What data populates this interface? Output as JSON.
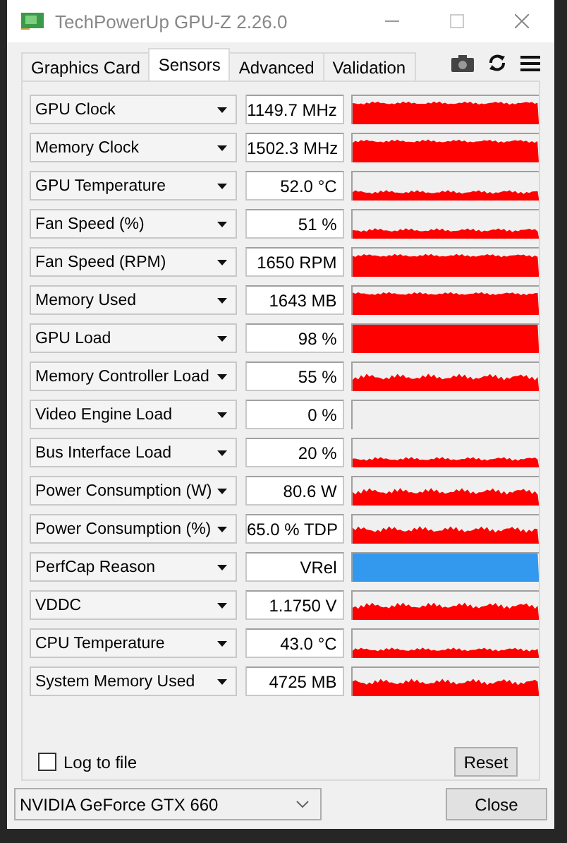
{
  "window": {
    "title": "TechPowerUp GPU-Z 2.26.0"
  },
  "tabs": [
    {
      "label": "Graphics Card",
      "selected": false
    },
    {
      "label": "Sensors",
      "selected": true
    },
    {
      "label": "Advanced",
      "selected": false
    },
    {
      "label": "Validation",
      "selected": false
    }
  ],
  "sensors": [
    {
      "name": "GPU Clock",
      "value": "1149.7 MHz",
      "kind": "high",
      "color": "#ff0000"
    },
    {
      "name": "Memory Clock",
      "value": "1502.3 MHz",
      "kind": "high",
      "color": "#ff0000"
    },
    {
      "name": "GPU Temperature",
      "value": "52.0 °C",
      "kind": "low",
      "color": "#ff0000"
    },
    {
      "name": "Fan Speed (%)",
      "value": "51 %",
      "kind": "low",
      "color": "#ff0000"
    },
    {
      "name": "Fan Speed (RPM)",
      "value": "1650 RPM",
      "kind": "high",
      "color": "#ff0000"
    },
    {
      "name": "Memory Used",
      "value": "1643 MB",
      "kind": "high",
      "color": "#ff0000"
    },
    {
      "name": "GPU Load",
      "value": "98 %",
      "kind": "full",
      "color": "#ff0000"
    },
    {
      "name": "Memory Controller Load",
      "value": "55 %",
      "kind": "mid",
      "color": "#ff0000"
    },
    {
      "name": "Video Engine Load",
      "value": "0 %",
      "kind": "empty"
    },
    {
      "name": "Bus Interface Load",
      "value": "20 %",
      "kind": "low",
      "color": "#ff0000"
    },
    {
      "name": "Power Consumption (W)",
      "value": "80.6 W",
      "kind": "mid",
      "color": "#ff0000"
    },
    {
      "name": "Power Consumption (%)",
      "value": "65.0 % TDP",
      "kind": "mid",
      "color": "#ff0000"
    },
    {
      "name": "PerfCap Reason",
      "value": "VRel",
      "kind": "full",
      "color": "#3399ee"
    },
    {
      "name": "VDDC",
      "value": "1.1750 V",
      "kind": "mid",
      "color": "#ff0000"
    },
    {
      "name": "CPU Temperature",
      "value": "43.0 °C",
      "kind": "low",
      "color": "#ff0000"
    },
    {
      "name": "System Memory Used",
      "value": "4725 MB",
      "kind": "mid",
      "color": "#ff0000"
    }
  ],
  "log_to_file": {
    "label": "Log to file",
    "checked": false
  },
  "reset_button": "Reset",
  "gpu_select": {
    "value": "NVIDIA GeForce GTX 660"
  },
  "close_button": "Close"
}
